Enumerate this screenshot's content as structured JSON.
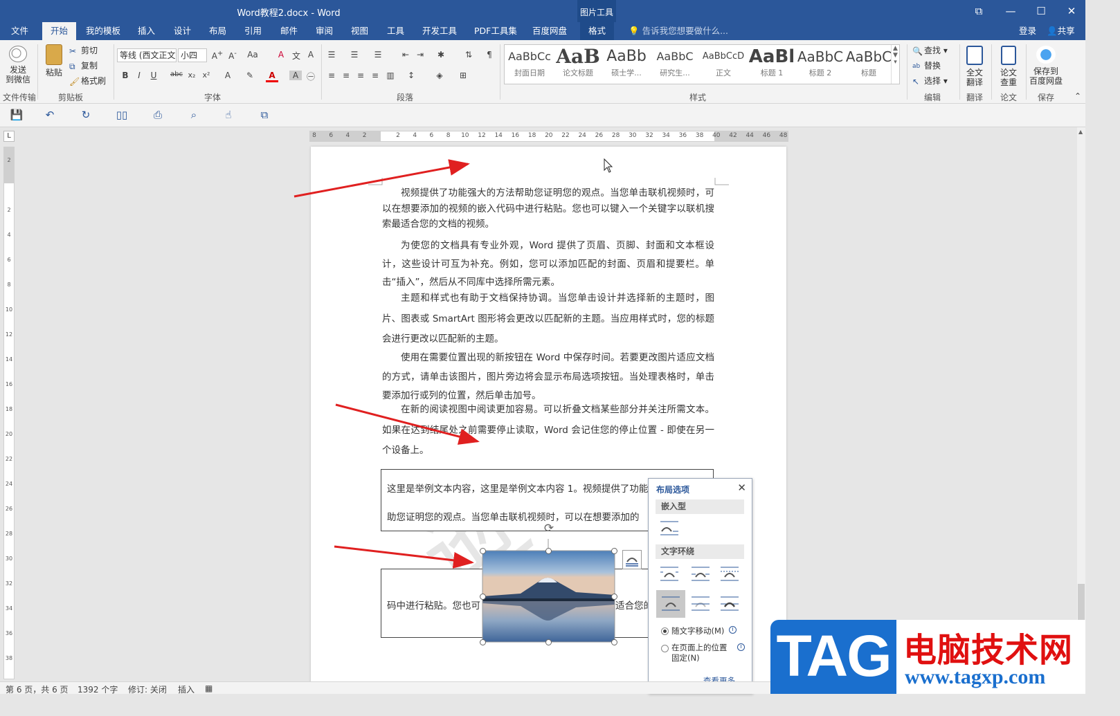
{
  "window": {
    "title": "Word教程2.docx - Word",
    "context_group": "图片工具",
    "controls": [
      "⧉",
      "—",
      "☐",
      "✕"
    ]
  },
  "tabs": {
    "file": "文件",
    "home": "开始",
    "templates": "我的模板",
    "insert": "插入",
    "design": "设计",
    "layout": "布局",
    "references": "引用",
    "mailings": "邮件",
    "review": "审阅",
    "view": "视图",
    "tools": "工具",
    "developer": "开发工具",
    "pdf": "PDF工具集",
    "baidu": "百度网盘",
    "format": "格式",
    "tell_me": "告诉我您想要做什么...",
    "signin": "登录",
    "share": "共享"
  },
  "ribbon": {
    "send_group": {
      "line1": "发送",
      "line2": "到微信",
      "label": "文件传输"
    },
    "clipboard": {
      "paste": "粘贴",
      "cut": "剪切",
      "copy": "复制",
      "format_painter": "格式刷",
      "label": "剪贴板"
    },
    "font": {
      "name": "等线 (西文正文)",
      "size": "小四",
      "label": "字体"
    },
    "paragraph": {
      "label": "段落"
    },
    "styles": {
      "label": "样式",
      "items": [
        {
          "preview": "AaBbCc",
          "name": "封面日期"
        },
        {
          "preview": "AaB",
          "name": "论文标题"
        },
        {
          "preview": "AaBb",
          "name": "硕士学..."
        },
        {
          "preview": "AaBbC",
          "name": "研究生..."
        },
        {
          "preview": "AaBbCcD",
          "name": "正文"
        },
        {
          "preview": "AaBl",
          "name": "标题 1"
        },
        {
          "preview": "AaBbC",
          "name": "标题 2"
        },
        {
          "preview": "AaBbC",
          "name": "标题"
        }
      ]
    },
    "editing": {
      "find": "查找",
      "replace": "替换",
      "select": "选择",
      "label": "编辑"
    },
    "translate": {
      "line1": "全文",
      "line2": "翻译",
      "label": "翻译"
    },
    "paper": {
      "line1": "论文",
      "line2": "查重",
      "label": "论文"
    },
    "save": {
      "line1": "保存到",
      "line2": "百度网盘",
      "label": "保存"
    }
  },
  "ruler": {
    "ticks": [
      "8",
      "6",
      "4",
      "2",
      "",
      "2",
      "4",
      "6",
      "8",
      "10",
      "12",
      "14",
      "16",
      "18",
      "20",
      "22",
      "24",
      "26",
      "28",
      "30",
      "32",
      "34",
      "36",
      "38",
      "40",
      "42",
      "44",
      "46",
      "48"
    ],
    "vticks": [
      "2",
      "",
      "2",
      "4",
      "6",
      "8",
      "10",
      "12",
      "14",
      "16",
      "18",
      "20",
      "22",
      "24",
      "26",
      "28",
      "30",
      "32",
      "34",
      "36",
      "38"
    ]
  },
  "document": {
    "paragraphs": [
      "视频提供了功能强大的方法帮助您证明您的观点。当您单击联机视频时，可以在想要添加的视频的嵌入代码中进行粘贴。您也可以键入一个关键字以联机搜索最适合您的文档的视频。",
      "为使您的文档具有专业外观，Word 提供了页眉、页脚、封面和文本框设计，这些设计可互为补充。例如，您可以添加匹配的封面、页眉和提要栏。单击“插入”，然后从不同库中选择所需元素。",
      "主题和样式也有助于文档保持协调。当您单击设计并选择新的主题时，图片、图表或 SmartArt 图形将会更改以匹配新的主题。当应用样式时，您的标题会进行更改以匹配新的主题。",
      "使用在需要位置出现的新按钮在 Word 中保存时间。若要更改图片适应文档的方式，请单击该图片，图片旁边将会显示布局选项按钮。当处理表格时，单击要添加行或列的位置，然后单击加号。",
      "在新的阅读视图中阅读更加容易。可以折叠文档某些部分并关注所需文本。如果在达到结尾处之前需要停止读取，Word 会记住您的停止位置 - 即使在另一个设备上。"
    ],
    "textbox1_line1": "这里是举例文本内容，这里是举例文本内容 1。视频提供了功能",
    "textbox1_line2": "助您证明您的观点。当您单击联机视频时，可以在想要添加的",
    "textbox2_left": "码中进行粘贴。您也可",
    "textbox2_right": "适合您的"
  },
  "layout_options": {
    "title": "布局选项",
    "inline_section": "嵌入型",
    "wrap_section": "文字环绕",
    "move_with_text": "随文字移动(M)",
    "fix_position_line1": "在页面上的位置",
    "fix_position_line2": "固定(N)",
    "see_more": "查看更多..."
  },
  "status": {
    "page": "第 6 页，共 6 页",
    "words": "1392 个字",
    "track": "修订: 关闭",
    "mode": "插入"
  },
  "watermark": {
    "logo": "TAG",
    "cn": "电脑技术网",
    "url": "www.tagxp.com"
  },
  "colors": {
    "accent": "#2b579a",
    "arrow": "#e02020",
    "wm_blue": "#1a6fce",
    "wm_red": "#e01010"
  }
}
